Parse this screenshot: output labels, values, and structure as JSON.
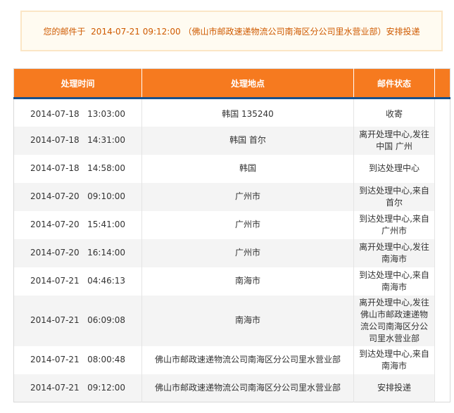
{
  "notice": {
    "text": "您的邮件于  2014-07-21 09:12:00 （佛山市邮政速递物流公司南海区分公司里水营业部）安排投递"
  },
  "table": {
    "headers": {
      "time": "处理时间",
      "location": "处理地点",
      "status": "邮件状态"
    },
    "rows": [
      {
        "time": "2014-07-18   13:03:00",
        "location": "韩国  135240",
        "status": "收寄"
      },
      {
        "time": "2014-07-18   14:31:00",
        "location": "韩国  首尔",
        "status": "离开处理中心,发往中国 广州"
      },
      {
        "time": "2014-07-18   14:58:00",
        "location": "韩国",
        "status": "到达处理中心"
      },
      {
        "time": "2014-07-20   09:10:00",
        "location": "广州市",
        "status": "到达处理中心,来自首尔"
      },
      {
        "time": "2014-07-20   15:41:00",
        "location": "广州市",
        "status": "到达处理中心,来自广州市"
      },
      {
        "time": "2014-07-20   16:14:00",
        "location": "广州市",
        "status": "离开处理中心,发往南海市"
      },
      {
        "time": "2014-07-21   04:46:13",
        "location": "南海市",
        "status": "到达处理中心,来自南海市"
      },
      {
        "time": "2014-07-21   06:09:08",
        "location": "南海市",
        "status": "离开处理中心,发往佛山市邮政速递物流公司南海区分公司里水营业部"
      },
      {
        "time": "2014-07-21   08:00:48",
        "location": "佛山市邮政速递物流公司南海区分公司里水营业部",
        "status": "到达处理中心,来自南海市"
      },
      {
        "time": "2014-07-21   09:12:00",
        "location": "佛山市邮政速递物流公司南海区分公司里水营业部",
        "status": "安排投递"
      }
    ]
  },
  "colors": {
    "header_bg": "#f67a1f",
    "header_underline": "#16508c",
    "notice_text": "#cf5a00",
    "notice_border": "#fbe6c6"
  }
}
